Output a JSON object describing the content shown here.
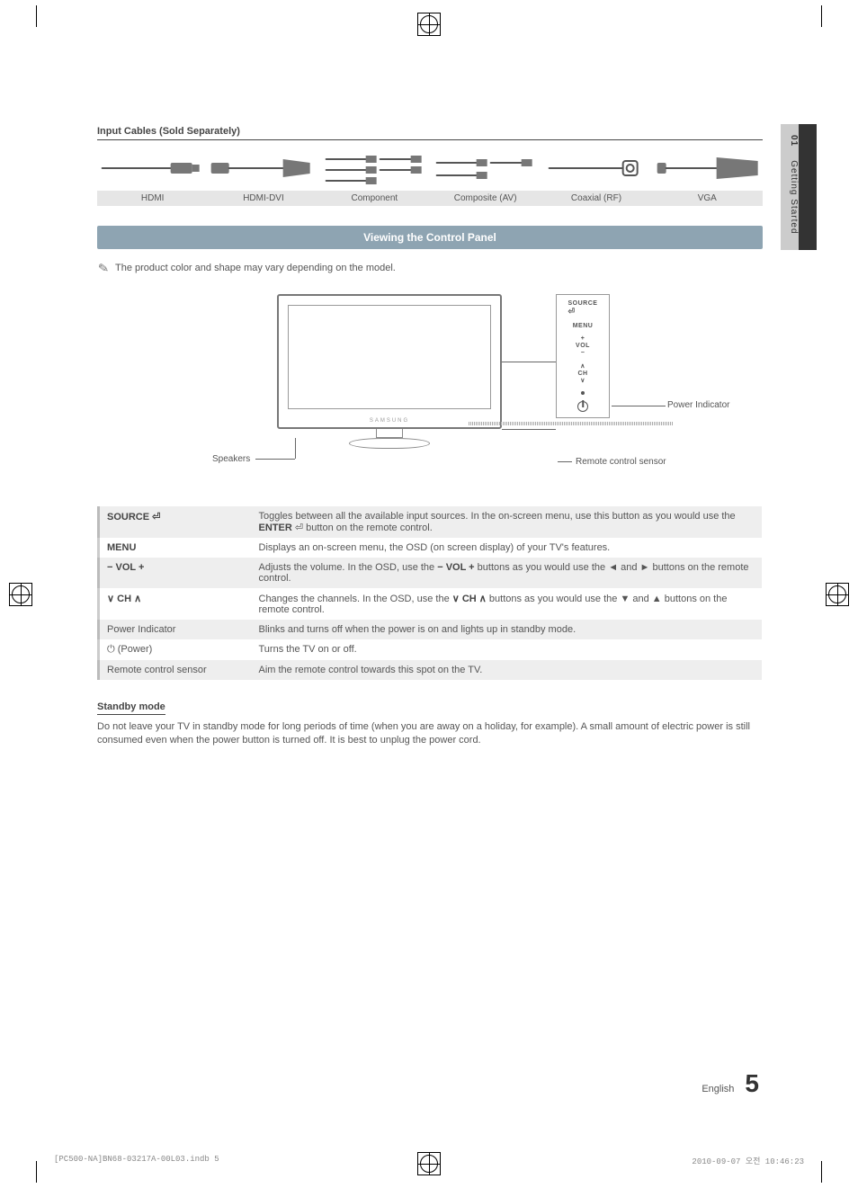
{
  "side_tab": {
    "number": "01",
    "label": "Getting Started"
  },
  "cables": {
    "header": "Input Cables (Sold Separately)",
    "items": [
      {
        "label": "HDMI"
      },
      {
        "label": "HDMI-DVI"
      },
      {
        "label": "Component"
      },
      {
        "label": "Composite (AV)"
      },
      {
        "label": "Coaxial (RF)"
      },
      {
        "label": "VGA"
      }
    ]
  },
  "section_title": "Viewing the Control Panel",
  "note": "The product color and shape may vary depending on the model.",
  "tv": {
    "speakers_label": "Speakers",
    "remote_sensor_label": "Remote control sensor",
    "power_indicator_label": "Power Indicator",
    "panel": {
      "source": "SOURCE",
      "menu": "MENU",
      "vol": "VOL",
      "ch": "CH"
    }
  },
  "controls": [
    {
      "name_html": "SOURCE <span class='sym'>⏎</span>",
      "desc_html": "Toggles between all the available input sources. In the on-screen menu, use this button as you would use the <span class='bold'>ENTER</span> <span class='sym'>⏎</span> button on the remote control."
    },
    {
      "name_html": "MENU",
      "desc_html": "Displays an on-screen menu, the OSD (on screen display) of your TV's features."
    },
    {
      "name_html": "<span class='sym'>−</span> VOL <span class='sym'>+</span>",
      "desc_html": "Adjusts the volume. In the OSD, use the <span class='bold'>− VOL +</span> buttons as you would use the ◄ and ► buttons on the remote control."
    },
    {
      "name_html": "<span class='sym'>∨</span> CH <span class='sym'>∧</span>",
      "desc_html": "Changes the channels. In the OSD, use the <span class='bold'>∨ CH ∧</span> buttons as you would use the ▼ and ▲ buttons on the remote control."
    },
    {
      "name_html": "Power Indicator",
      "plain": true,
      "desc_html": "Blinks and turns off when the power is on and lights up in standby mode."
    },
    {
      "name_html": "<span class='sym'>⏻</span> (Power)",
      "plain": true,
      "desc_html": "Turns the TV on or off."
    },
    {
      "name_html": "Remote control sensor",
      "plain": true,
      "desc_html": "Aim the remote control towards this spot on the TV."
    }
  ],
  "standby": {
    "heading": "Standby mode",
    "text": "Do not leave your TV in standby mode for long periods of time (when you are away on a holiday, for example). A small amount of electric power is still consumed even when the power button is turned off. It is best to unplug the power cord."
  },
  "footer": {
    "lang": "English",
    "page": "5"
  },
  "print_footer": {
    "left": "[PC500-NA]BN68-03217A-00L03.indb   5",
    "right": "2010-09-07   오전 10:46:23"
  }
}
